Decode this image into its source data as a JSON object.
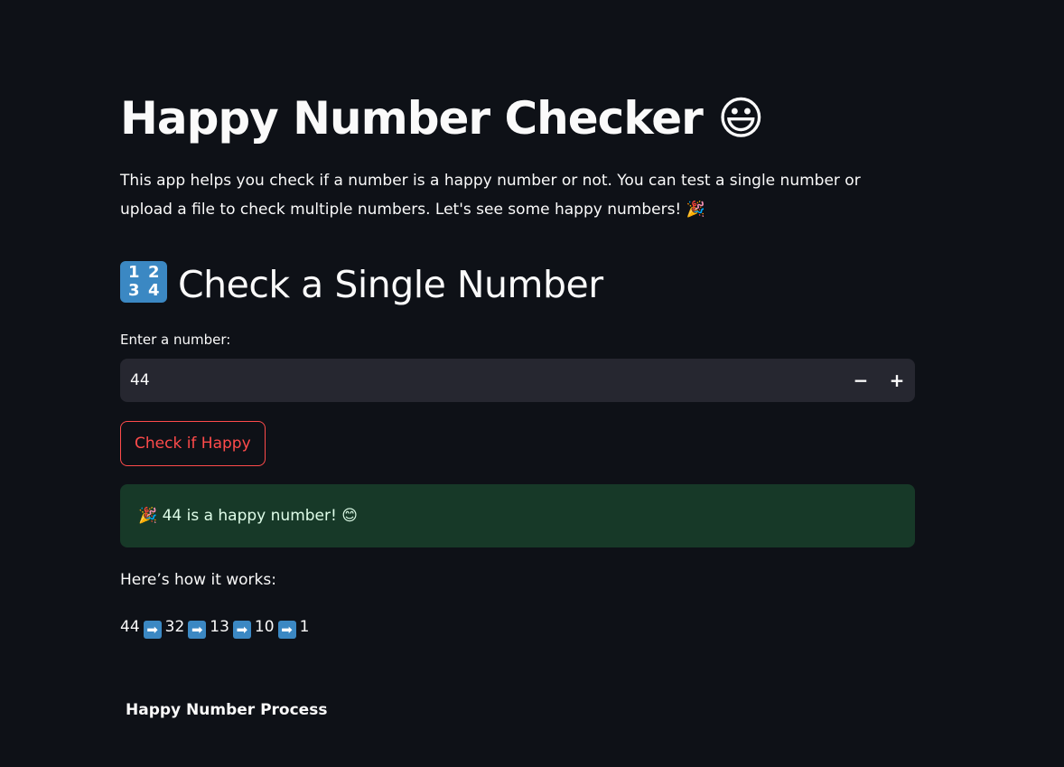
{
  "header": {
    "title": "Happy Number Checker 😃",
    "intro": "This app helps you check if a number is a happy number or not. You can test a single number or upload a file to check multiple numbers. Let's see some happy numbers! 🎉"
  },
  "single_check": {
    "section_title": "Check a Single Number",
    "section_icon": "keycap-1234-icon",
    "keycap_digits": [
      "1",
      "2",
      "3",
      "4"
    ],
    "input_label": "Enter a number:",
    "input_value": "44",
    "minus_label": "−",
    "plus_label": "+",
    "button_label": "Check if Happy",
    "result_message": "🎉 44 is a happy number! 😊",
    "how_label": "Here’s how it works:",
    "sequence": [
      "44",
      "32",
      "13",
      "10",
      "1"
    ],
    "arrow_glyph": "➡"
  },
  "chart": {
    "title": "Happy Number Process"
  },
  "colors": {
    "background": "#0e1117",
    "accent": "#ff4b4b",
    "input_bg": "#262730",
    "success_bg": "#173928",
    "success_text": "#dffde9",
    "keycap_blue": "#3b88c3"
  }
}
